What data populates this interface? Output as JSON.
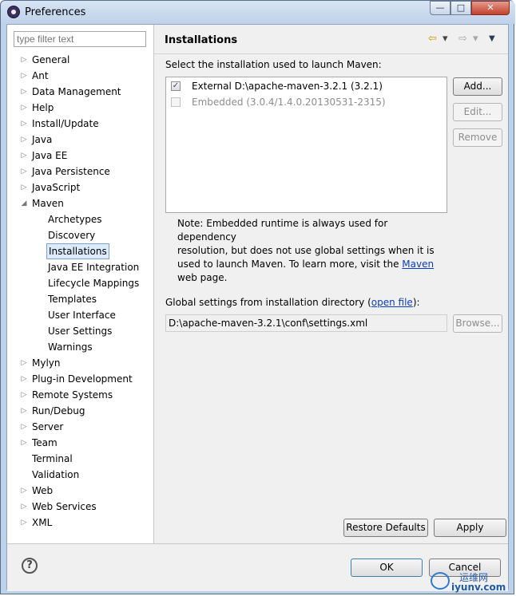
{
  "window": {
    "title": "Preferences",
    "minimize_glyph": "—",
    "maximize_glyph": "□",
    "close_glyph": "✕"
  },
  "filter": {
    "placeholder": "type filter text"
  },
  "tree": [
    {
      "label": "General",
      "level": 0,
      "expandable": true,
      "expanded": false
    },
    {
      "label": "Ant",
      "level": 0,
      "expandable": true,
      "expanded": false
    },
    {
      "label": "Data Management",
      "level": 0,
      "expandable": true,
      "expanded": false
    },
    {
      "label": "Help",
      "level": 0,
      "expandable": true,
      "expanded": false
    },
    {
      "label": "Install/Update",
      "level": 0,
      "expandable": true,
      "expanded": false
    },
    {
      "label": "Java",
      "level": 0,
      "expandable": true,
      "expanded": false
    },
    {
      "label": "Java EE",
      "level": 0,
      "expandable": true,
      "expanded": false
    },
    {
      "label": "Java Persistence",
      "level": 0,
      "expandable": true,
      "expanded": false
    },
    {
      "label": "JavaScript",
      "level": 0,
      "expandable": true,
      "expanded": false
    },
    {
      "label": "Maven",
      "level": 0,
      "expandable": true,
      "expanded": true
    },
    {
      "label": "Archetypes",
      "level": 1,
      "expandable": false
    },
    {
      "label": "Discovery",
      "level": 1,
      "expandable": false
    },
    {
      "label": "Installations",
      "level": 1,
      "expandable": false,
      "selected": true
    },
    {
      "label": "Java EE Integration",
      "level": 1,
      "expandable": false
    },
    {
      "label": "Lifecycle Mappings",
      "level": 1,
      "expandable": false
    },
    {
      "label": "Templates",
      "level": 1,
      "expandable": false
    },
    {
      "label": "User Interface",
      "level": 1,
      "expandable": false
    },
    {
      "label": "User Settings",
      "level": 1,
      "expandable": false
    },
    {
      "label": "Warnings",
      "level": 1,
      "expandable": false
    },
    {
      "label": "Mylyn",
      "level": 0,
      "expandable": true,
      "expanded": false
    },
    {
      "label": "Plug-in Development",
      "level": 0,
      "expandable": true,
      "expanded": false
    },
    {
      "label": "Remote Systems",
      "level": 0,
      "expandable": true,
      "expanded": false
    },
    {
      "label": "Run/Debug",
      "level": 0,
      "expandable": true,
      "expanded": false
    },
    {
      "label": "Server",
      "level": 0,
      "expandable": true,
      "expanded": false
    },
    {
      "label": "Team",
      "level": 0,
      "expandable": true,
      "expanded": false
    },
    {
      "label": "Terminal",
      "level": 0,
      "expandable": false
    },
    {
      "label": "Validation",
      "level": 0,
      "expandable": false
    },
    {
      "label": "Web",
      "level": 0,
      "expandable": true,
      "expanded": false
    },
    {
      "label": "Web Services",
      "level": 0,
      "expandable": true,
      "expanded": false
    },
    {
      "label": "XML",
      "level": 0,
      "expandable": true,
      "expanded": false
    }
  ],
  "page": {
    "title": "Installations",
    "nav": {
      "back_glyph": "⇦",
      "dropdown_glyph": "▾",
      "forward_glyph": "⇨",
      "menu_glyph": "▼"
    },
    "select_label": "Select the installation used to launch Maven:",
    "installations": [
      {
        "text": "External D:\\apache-maven-3.2.1 (3.2.1)",
        "checked": true,
        "enabled": true
      },
      {
        "text": "Embedded (3.0.4/1.4.0.20130531-2315)",
        "checked": false,
        "enabled": false
      }
    ],
    "buttons": {
      "add": "Add...",
      "edit": "Edit...",
      "remove": "Remove"
    },
    "note": {
      "line1": "Note: Embedded runtime is always used for dependency",
      "line2": "resolution, but does not use global settings when it is",
      "line3_prefix": "used to launch Maven. To learn more, visit the ",
      "link": "Maven",
      "line4": "web page."
    },
    "global": {
      "label_prefix": "Global settings from installation directory (",
      "link": "open file",
      "label_suffix": "):",
      "path": "D:\\apache-maven-3.2.1\\conf\\settings.xml",
      "browse": "Browse..."
    },
    "restore_defaults": "Restore Defaults",
    "apply": "Apply"
  },
  "footer": {
    "help_glyph": "?",
    "ok": "OK",
    "cancel": "Cancel"
  },
  "watermark": {
    "top": "运维网",
    "bottom": "iyunv.com"
  },
  "colors": {
    "link": "#0b3dbb",
    "selection": "#dcebfc",
    "close_button": "#c2412c"
  }
}
